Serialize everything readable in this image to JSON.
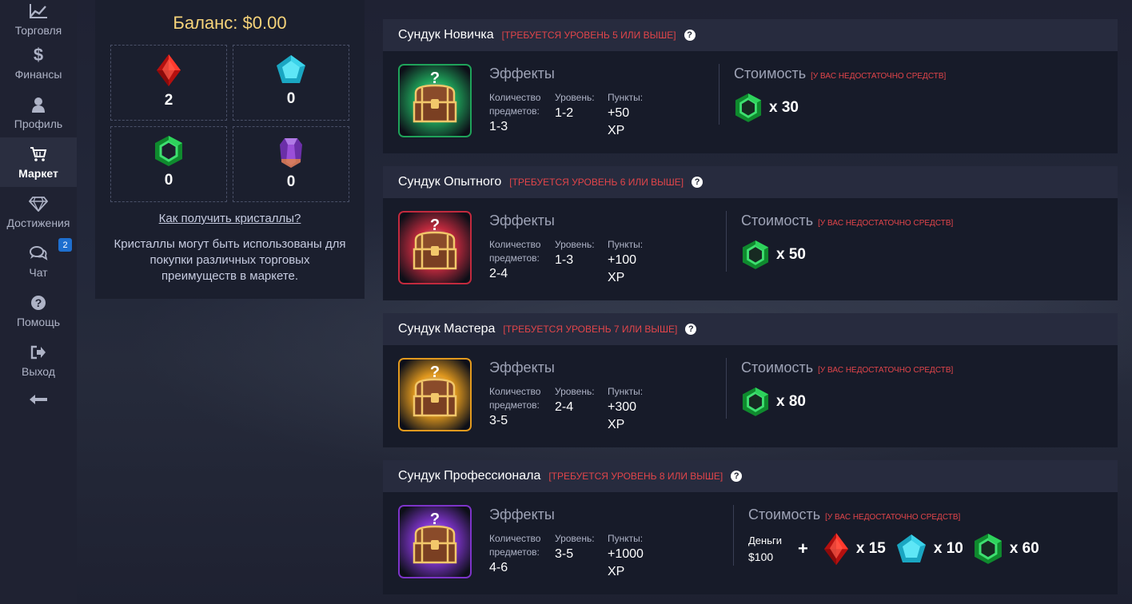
{
  "sidebar": {
    "items": [
      {
        "label": "Торговля",
        "icon": "chart-line-icon"
      },
      {
        "label": "Финансы",
        "icon": "dollar-icon"
      },
      {
        "label": "Профиль",
        "icon": "user-icon"
      },
      {
        "label": "Маркет",
        "icon": "cart-icon",
        "active": true
      },
      {
        "label": "Достижения",
        "icon": "diamond-icon"
      },
      {
        "label": "Чат",
        "icon": "chat-icon",
        "badge": "2"
      },
      {
        "label": "Помощь",
        "icon": "question-icon"
      },
      {
        "label": "Выход",
        "icon": "logout-icon"
      }
    ],
    "back_icon": "arrow-left-icon"
  },
  "balance": {
    "title": "Баланс: $0.00",
    "crystals": [
      {
        "name": "ruby",
        "count": "2",
        "color": "#e8201c"
      },
      {
        "name": "sapphire",
        "count": "0",
        "color": "#2bc3d8"
      },
      {
        "name": "emerald",
        "count": "0",
        "color": "#20b544"
      },
      {
        "name": "amethyst",
        "count": "0",
        "color": "#8e44c8"
      }
    ],
    "how_link": "Как получить кристаллы?",
    "description": "Кристаллы могут быть использованы для покупки различных торговых преимуществ в маркете."
  },
  "labels": {
    "effects": "Эффекты",
    "items_count": "Количество предметов:",
    "level": "Уровень:",
    "points": "Пункты:",
    "cost": "Стоимость",
    "insufficient": "[У ВАС НЕДОСТАТОЧНО СРЕДСТВ]",
    "money": "Деньги",
    "plus": "+"
  },
  "chests": [
    {
      "title": "Сундук Новичка",
      "requirement": "[ТРЕБУЕТСЯ УРОВЕНЬ 5 ИЛИ ВЫШЕ]",
      "theme": "#1fa35a",
      "items": "1-3",
      "level": "1-2",
      "points": "+50",
      "points_unit": "XP",
      "cost": "x 30"
    },
    {
      "title": "Сундук Опытного",
      "requirement": "[ТРЕБУЕТСЯ УРОВЕНЬ 6 ИЛИ ВЫШЕ]",
      "theme": "#c22a3e",
      "items": "2-4",
      "level": "1-3",
      "points": "+100",
      "points_unit": "XP",
      "cost": "x 50"
    },
    {
      "title": "Сундук Мастера",
      "requirement": "[ТРЕБУЕТСЯ УРОВЕНЬ 7 ИЛИ ВЫШЕ]",
      "theme": "#e39a1e",
      "items": "3-5",
      "level": "2-4",
      "points": "+300",
      "points_unit": "XP",
      "cost": "x 80"
    },
    {
      "title": "Сундук Профессионала",
      "requirement": "[ТРЕБУЕТСЯ УРОВЕНЬ 8 ИЛИ ВЫШЕ]",
      "theme": "#7d34c9",
      "items": "4-6",
      "level": "3-5",
      "points": "+1000",
      "points_unit": "XP",
      "money": "$100",
      "cost_ruby": "x 15",
      "cost_sapphire": "x 10",
      "cost_emerald": "x 60"
    }
  ]
}
